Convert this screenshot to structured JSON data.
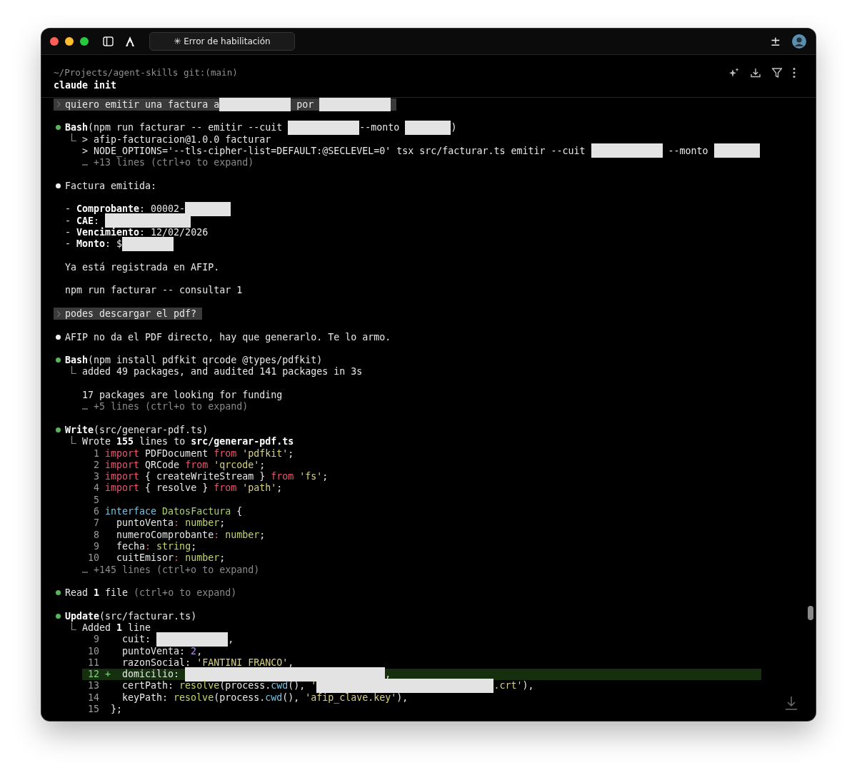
{
  "window": {
    "tab": {
      "label": "✳ Error de habilitación"
    },
    "toolbar_glyph": "±"
  },
  "session": {
    "path": "~/Projects/agent-skills git:(main)",
    "command": "claude init"
  },
  "transcript": [
    {
      "lines": [
        {
          "kind": "prompt",
          "segments": [
            {
              "kind": "plain",
              "text": "quiero emitir una factura a"
            },
            {
              "kind": "redacted_medium"
            },
            {
              "kind": "plain",
              "text": " por "
            },
            {
              "kind": "redacted_medium"
            }
          ]
        }
      ]
    },
    {
      "lines": [
        {
          "kind": "tool",
          "segments": [
            {
              "kind": "bold",
              "text": "Bash"
            },
            {
              "kind": "plain",
              "text": "(npm run facturar -- emitir --cuit "
            },
            {
              "kind": "redacted_medium"
            },
            {
              "kind": "plain",
              "text": "--monto "
            },
            {
              "kind": "redacted_short"
            },
            {
              "kind": "plain",
              "text": ")"
            }
          ]
        },
        {
          "kind": "result",
          "segments": [
            {
              "kind": "plain",
              "text": "> afip-facturacion@1.0.0 facturar"
            }
          ]
        },
        {
          "kind": "output",
          "segments": [
            {
              "kind": "plain",
              "text": "> NODE_OPTIONS='--tls-cipher-list=DEFAULT:@SECLEVEL=0' tsx src/facturar.ts emitir --cuit "
            },
            {
              "kind": "redacted_medium"
            },
            {
              "kind": "plain",
              "text": " --monto "
            },
            {
              "kind": "redacted_short"
            }
          ]
        },
        {
          "kind": "more",
          "segments": [
            {
              "kind": "dim",
              "text": "… +13 lines (ctrl+o to expand)"
            }
          ]
        }
      ]
    },
    {
      "lines": [
        {
          "kind": "message",
          "segments": [
            {
              "kind": "plain",
              "text": "Factura emitida:"
            }
          ]
        }
      ]
    },
    {
      "lines": [
        {
          "kind": "body",
          "segments": [
            {
              "kind": "plain",
              "text": "- "
            },
            {
              "kind": "bold",
              "text": "Comprobante"
            },
            {
              "kind": "plain",
              "text": ": 00002-"
            },
            {
              "kind": "redacted_short"
            }
          ]
        },
        {
          "kind": "body",
          "segments": [
            {
              "kind": "plain",
              "text": "- "
            },
            {
              "kind": "bold",
              "text": "CAE"
            },
            {
              "kind": "plain",
              "text": ": "
            },
            {
              "kind": "redacted_long"
            }
          ]
        },
        {
          "kind": "body",
          "segments": [
            {
              "kind": "plain",
              "text": "- "
            },
            {
              "kind": "bold",
              "text": "Vencimiento"
            },
            {
              "kind": "plain",
              "text": ": 12/02/2026"
            }
          ]
        },
        {
          "kind": "body",
          "segments": [
            {
              "kind": "plain",
              "text": "- "
            },
            {
              "kind": "bold",
              "text": "Monto"
            },
            {
              "kind": "plain",
              "text": ": $"
            },
            {
              "kind": "redacted_small"
            }
          ]
        }
      ]
    },
    {
      "lines": [
        {
          "kind": "body",
          "segments": [
            {
              "kind": "plain",
              "text": "Ya está registrada en AFIP."
            }
          ]
        }
      ]
    },
    {
      "lines": [
        {
          "kind": "body",
          "segments": [
            {
              "kind": "plain",
              "text": "npm run facturar -- consultar 1"
            }
          ]
        }
      ]
    },
    {
      "lines": [
        {
          "kind": "prompt",
          "segments": [
            {
              "kind": "plain",
              "text": "podes descargar el pdf?"
            }
          ]
        }
      ]
    },
    {
      "lines": [
        {
          "kind": "message",
          "segments": [
            {
              "kind": "plain",
              "text": "AFIP no da el PDF directo, hay que generarlo. Te lo armo."
            }
          ]
        }
      ]
    },
    {
      "lines": [
        {
          "kind": "tool",
          "segments": [
            {
              "kind": "bold",
              "text": "Bash"
            },
            {
              "kind": "plain",
              "text": "(npm install pdfkit qrcode @types/pdfkit)"
            }
          ]
        },
        {
          "kind": "result",
          "segments": [
            {
              "kind": "plain",
              "text": "added 49 packages, and audited 141 packages in 3s"
            }
          ]
        }
      ]
    },
    {
      "lines": [
        {
          "kind": "output",
          "segments": [
            {
              "kind": "plain",
              "text": "17 packages are looking for funding"
            }
          ]
        },
        {
          "kind": "more",
          "segments": [
            {
              "kind": "dim",
              "text": "… +5 lines (ctrl+o to expand)"
            }
          ]
        }
      ]
    },
    {
      "lines": [
        {
          "kind": "tool",
          "segments": [
            {
              "kind": "bold",
              "text": "Write"
            },
            {
              "kind": "plain",
              "text": "(src/generar-pdf.ts)"
            }
          ]
        },
        {
          "kind": "result",
          "segments": [
            {
              "kind": "plain",
              "text": "Wrote "
            },
            {
              "kind": "bold",
              "text": "155"
            },
            {
              "kind": "plain",
              "text": " lines to "
            },
            {
              "kind": "bold",
              "text": "src/generar-pdf.ts"
            }
          ]
        },
        {
          "kind": "code",
          "number": "1",
          "segments": [
            {
              "kind": "keyword",
              "text": "import"
            },
            {
              "kind": "plain",
              "text": " PDFDocument "
            },
            {
              "kind": "keyword",
              "text": "from"
            },
            {
              "kind": "string",
              "text": " 'pdfkit'"
            },
            {
              "kind": "plain",
              "text": ";"
            }
          ]
        },
        {
          "kind": "code",
          "number": "2",
          "segments": [
            {
              "kind": "keyword",
              "text": "import"
            },
            {
              "kind": "plain",
              "text": " QRCode "
            },
            {
              "kind": "keyword",
              "text": "from"
            },
            {
              "kind": "string",
              "text": " 'qrcode'"
            },
            {
              "kind": "plain",
              "text": ";"
            }
          ]
        },
        {
          "kind": "code",
          "number": "3",
          "segments": [
            {
              "kind": "keyword",
              "text": "import"
            },
            {
              "kind": "plain",
              "text": " { createWriteStream } "
            },
            {
              "kind": "keyword",
              "text": "from"
            },
            {
              "kind": "string",
              "text": " 'fs'"
            },
            {
              "kind": "plain",
              "text": ";"
            }
          ]
        },
        {
          "kind": "code",
          "number": "4",
          "segments": [
            {
              "kind": "keyword",
              "text": "import"
            },
            {
              "kind": "plain",
              "text": " { resolve } "
            },
            {
              "kind": "keyword",
              "text": "from"
            },
            {
              "kind": "string",
              "text": " 'path'"
            },
            {
              "kind": "plain",
              "text": ";"
            }
          ]
        },
        {
          "kind": "code",
          "number": "5"
        },
        {
          "kind": "code",
          "number": "6",
          "segments": [
            {
              "kind": "iface",
              "text": "interface"
            },
            {
              "kind": "class",
              "text": " DatosFactura"
            },
            {
              "kind": "plain",
              "text": " {"
            }
          ]
        },
        {
          "kind": "code",
          "number": "7",
          "segments": [
            {
              "kind": "plain",
              "text": "  puntoVenta"
            },
            {
              "kind": "operator",
              "text": ":"
            },
            {
              "kind": "type",
              "text": " number"
            },
            {
              "kind": "plain",
              "text": ";"
            }
          ]
        },
        {
          "kind": "code",
          "number": "8",
          "segments": [
            {
              "kind": "plain",
              "text": "  numeroComprobante"
            },
            {
              "kind": "operator",
              "text": ":"
            },
            {
              "kind": "type",
              "text": " number"
            },
            {
              "kind": "plain",
              "text": ";"
            }
          ]
        },
        {
          "kind": "code",
          "number": "9",
          "segments": [
            {
              "kind": "plain",
              "text": "  fecha"
            },
            {
              "kind": "operator",
              "text": ":"
            },
            {
              "kind": "type",
              "text": " string"
            },
            {
              "kind": "plain",
              "text": ";"
            }
          ]
        },
        {
          "kind": "code",
          "number": "10",
          "segments": [
            {
              "kind": "plain",
              "text": "  cuitEmisor"
            },
            {
              "kind": "operator",
              "text": ":"
            },
            {
              "kind": "type",
              "text": " number"
            },
            {
              "kind": "plain",
              "text": ";"
            }
          ]
        },
        {
          "kind": "more",
          "segments": [
            {
              "kind": "dim",
              "text": "… +145 lines (ctrl+o to expand)"
            }
          ]
        }
      ]
    },
    {
      "lines": [
        {
          "kind": "tool",
          "segments": [
            {
              "kind": "plain",
              "text": "Read "
            },
            {
              "kind": "bold",
              "text": "1"
            },
            {
              "kind": "plain",
              "text": " file "
            },
            {
              "kind": "dim",
              "text": "(ctrl+o to expand)"
            }
          ]
        }
      ]
    },
    {
      "lines": [
        {
          "kind": "tool",
          "segments": [
            {
              "kind": "bold",
              "text": "Update"
            },
            {
              "kind": "plain",
              "text": "(src/facturar.ts)"
            }
          ]
        },
        {
          "kind": "result",
          "segments": [
            {
              "kind": "plain",
              "text": "Added "
            },
            {
              "kind": "bold",
              "text": "1"
            },
            {
              "kind": "plain",
              "text": " line"
            }
          ]
        },
        {
          "kind": "diff",
          "number": "9",
          "added": false,
          "segments": [
            {
              "kind": "plain",
              "text": "  cuit: "
            },
            {
              "kind": "redacted_medium"
            },
            {
              "kind": "plain",
              "text": ","
            }
          ]
        },
        {
          "kind": "diff",
          "number": "10",
          "added": false,
          "segments": [
            {
              "kind": "plain",
              "text": "  puntoVenta: "
            },
            {
              "kind": "number",
              "text": "2"
            },
            {
              "kind": "plain",
              "text": ","
            }
          ]
        },
        {
          "kind": "diff",
          "number": "11",
          "added": false,
          "segments": [
            {
              "kind": "plain",
              "text": "  razonSocial: "
            },
            {
              "kind": "string",
              "text": "'FANTINI FRANCO'"
            },
            {
              "kind": "plain",
              "text": ","
            }
          ]
        },
        {
          "kind": "diff",
          "number": "12",
          "added": true,
          "marker": "+",
          "segments": [
            {
              "kind": "plain",
              "text": "  domicilio: "
            },
            {
              "kind": "redacted_widest"
            },
            {
              "kind": "plain",
              "text": ","
            }
          ]
        },
        {
          "kind": "diff",
          "number": "13",
          "added": false,
          "segments": [
            {
              "kind": "plain",
              "text": "  certPath: "
            },
            {
              "kind": "func",
              "text": "resolve"
            },
            {
              "kind": "plain",
              "text": "(process."
            },
            {
              "kind": "prop",
              "text": "cwd"
            },
            {
              "kind": "plain",
              "text": "(), "
            },
            {
              "kind": "string",
              "text": "'"
            },
            {
              "kind": "redacted_wide"
            },
            {
              "kind": "string",
              "text": ".crt'"
            },
            {
              "kind": "plain",
              "text": "),"
            }
          ]
        },
        {
          "kind": "diff",
          "number": "14",
          "added": false,
          "segments": [
            {
              "kind": "plain",
              "text": "  keyPath: "
            },
            {
              "kind": "func",
              "text": "resolve"
            },
            {
              "kind": "plain",
              "text": "(process."
            },
            {
              "kind": "prop",
              "text": "cwd"
            },
            {
              "kind": "plain",
              "text": "(), "
            },
            {
              "kind": "string",
              "text": "'afip_clave.key'"
            },
            {
              "kind": "plain",
              "text": "),"
            }
          ]
        },
        {
          "kind": "diff",
          "number": "15",
          "added": false,
          "segments": [
            {
              "kind": "plain",
              "text": "};"
            }
          ]
        }
      ]
    }
  ]
}
